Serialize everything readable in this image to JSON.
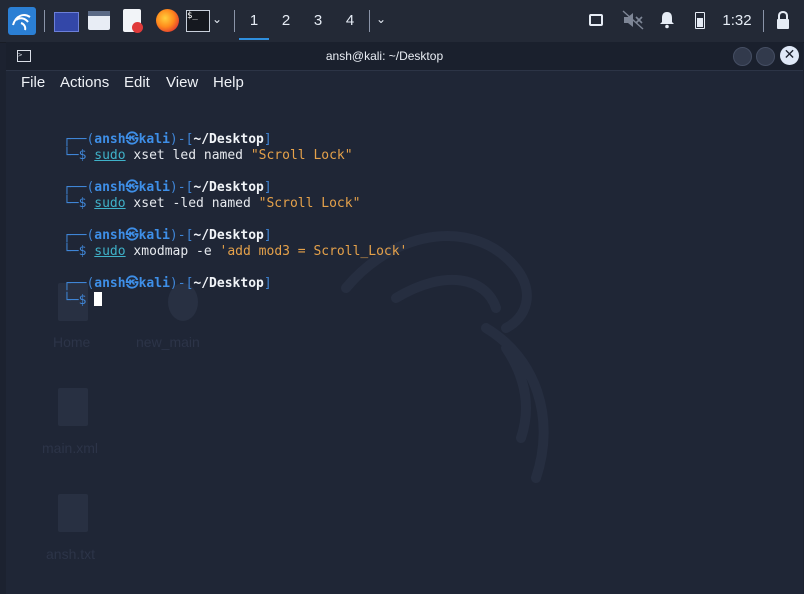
{
  "taskbar": {
    "workspaces": [
      "1",
      "2",
      "3",
      "4"
    ],
    "active_workspace": "1",
    "clock": "1:32",
    "icons": [
      "kali-menu-icon",
      "show-desktop-icon",
      "file-manager-icon",
      "text-editor-icon",
      "firefox-icon",
      "terminal-icon",
      "chevron-down-icon",
      "workspace-menu-icon",
      "network-icon",
      "volume-muted-icon",
      "notification-bell-icon",
      "battery-icon",
      "lock-icon"
    ]
  },
  "window": {
    "title": "ansh@kali: ~/Desktop",
    "menu": [
      "File",
      "Actions",
      "Edit",
      "View",
      "Help"
    ]
  },
  "terminal": {
    "prompts": [
      {
        "user": "ansh",
        "at": "㉿",
        "host": "kali",
        "path": "~/Desktop",
        "cmd": "sudo",
        "args": "xset led named",
        "string": "\"Scroll Lock\""
      },
      {
        "user": "ansh",
        "at": "㉿",
        "host": "kali",
        "path": "~/Desktop",
        "cmd": "sudo",
        "args": "xset -led named",
        "string": "\"Scroll Lock\""
      },
      {
        "user": "ansh",
        "at": "㉿",
        "host": "kali",
        "path": "~/Desktop",
        "cmd": "sudo",
        "args": "xmodmap -e",
        "string": "'add mod3 = Scroll_Lock'"
      },
      {
        "user": "ansh",
        "at": "㉿",
        "host": "kali",
        "path": "~/Desktop",
        "cmd": "",
        "args": "",
        "string": ""
      }
    ],
    "prompt_left": "┌──(",
    "prompt_mid": ")-[",
    "prompt_right": "]",
    "prompt_second": "└─$"
  },
  "desktop_ghosts": [
    "Home",
    "new_main",
    "main.xml",
    "ansh.txt"
  ],
  "colors": {
    "accent": "#2f8fde",
    "user": "#3e8fe8",
    "string": "#e5a14a",
    "command": "#3fb2c9"
  }
}
